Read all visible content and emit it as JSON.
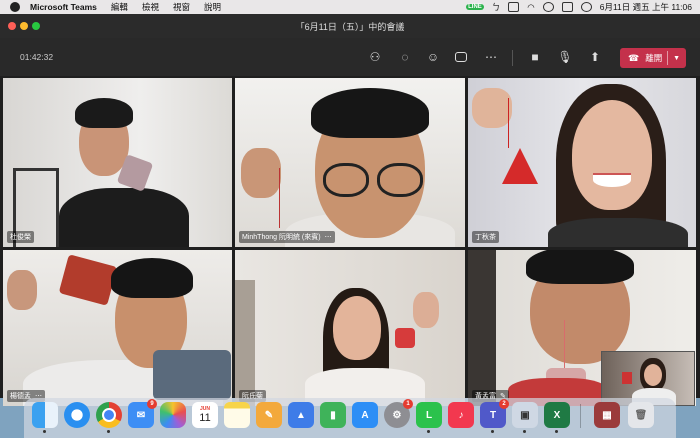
{
  "menubar": {
    "app_name": "Microsoft Teams",
    "menus": [
      "編輯",
      "檢視",
      "視窗",
      "說明"
    ],
    "line_badge": "LINE",
    "clock": "6月11日 週五 上午 11:06"
  },
  "window": {
    "title": "「6月11日（五）」中的會議"
  },
  "toolbar": {
    "timer": "01:42:32",
    "leave_label": "離開",
    "leave_color": "#c4314b"
  },
  "participants": [
    {
      "name": "杜俊榮",
      "more": ""
    },
    {
      "name": "MinhThong 阮明統 (來賓)",
      "more": "⋯"
    },
    {
      "name": "丁秋茶",
      "more": ""
    },
    {
      "name": "楊德孟",
      "more": "⋯"
    },
    {
      "name": "阮氏菊",
      "more": ""
    },
    {
      "name": "黃孟富",
      "more": "✎"
    }
  ],
  "dock": {
    "mail_badge": "9",
    "calendar_month": "JUN",
    "calendar_day": "11",
    "settings_badge": "1",
    "teams_badge": "2",
    "icons": [
      "finder-icon",
      "safari-icon",
      "chrome-icon",
      "mail-icon",
      "photos-icon",
      "calendar-icon",
      "notes-icon",
      "pages-icon",
      "keynote-icon",
      "numbers-icon",
      "appstore-icon",
      "settings-icon",
      "line-icon",
      "music-icon",
      "teams-icon",
      "preview-icon",
      "excel-icon",
      "photobooth-icon",
      "trash-icon"
    ]
  }
}
